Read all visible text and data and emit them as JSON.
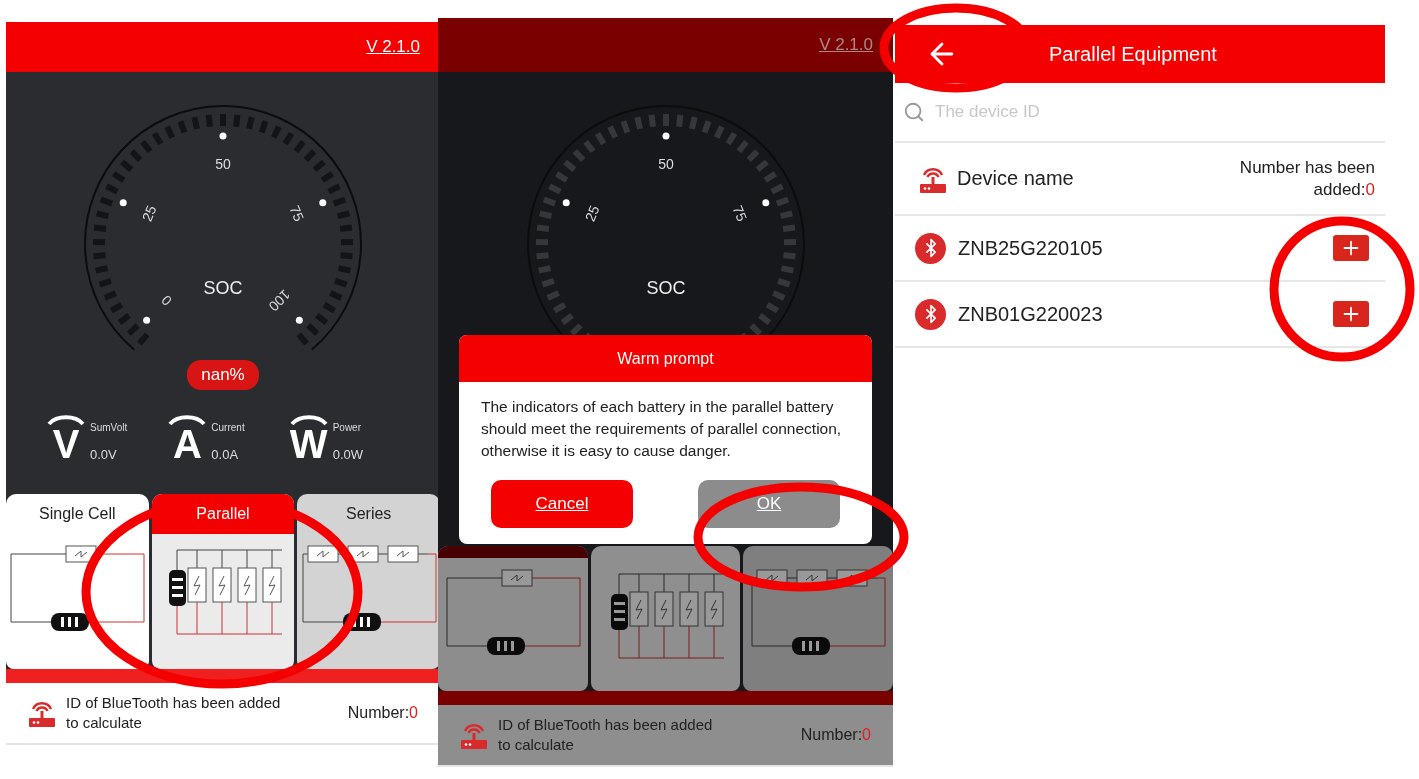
{
  "screens": [
    {
      "kind": "dashboard",
      "version": "V 2.1.0",
      "gauge": {
        "kind": "full",
        "label": "SOC",
        "ticks": [
          "0",
          "25",
          "50",
          "75",
          "100"
        ],
        "reading": "nan%"
      },
      "metrics": [
        {
          "symbol": "V",
          "label": "SumVolt",
          "value": "0.0V"
        },
        {
          "symbol": "A",
          "label": "Current",
          "value": "0.0A"
        },
        {
          "symbol": "W",
          "label": "Power",
          "value": "0.0W"
        }
      ],
      "modes": [
        {
          "kind": "single",
          "label": "Single Cell",
          "selected": false
        },
        {
          "kind": "parallel",
          "label": "Parallel",
          "selected": true
        },
        {
          "kind": "series",
          "label": "Series",
          "selected": false
        }
      ],
      "footer": {
        "text": "ID of BlueTooth has been added to calculate",
        "count_label": "Number:",
        "count": "0"
      }
    },
    {
      "kind": "dashboard",
      "version": "V 2.1.0",
      "gauge": {
        "kind": "partial",
        "label": "SOC",
        "ticks": [
          "25",
          "50",
          "75"
        ]
      },
      "dialog": {
        "title": "Warm prompt",
        "message": "The indicators of each battery in the parallel battery should meet the requirements of parallel connection, otherwise it is easy to cause danger.",
        "buttons": [
          {
            "kind": "primary",
            "label": "Cancel"
          },
          {
            "kind": "secondary",
            "label": "OK"
          }
        ]
      },
      "modes": [
        {
          "kind": "single",
          "selected": true
        },
        {
          "kind": "parallel",
          "selected": false
        },
        {
          "kind": "series",
          "selected": false
        }
      ],
      "footer": {
        "text": "ID of BlueTooth has been added to calculate",
        "count_label": "Number:",
        "count": "0"
      }
    },
    {
      "kind": "device_list",
      "title": "Parallel Equipment",
      "search": {
        "placeholder": "The device ID"
      },
      "header": {
        "label": "Device name",
        "count_label": "Number has been added:",
        "count": "0"
      },
      "devices": [
        {
          "id": "ZNB25G220105"
        },
        {
          "id": "ZNB01G220023"
        }
      ]
    }
  ]
}
